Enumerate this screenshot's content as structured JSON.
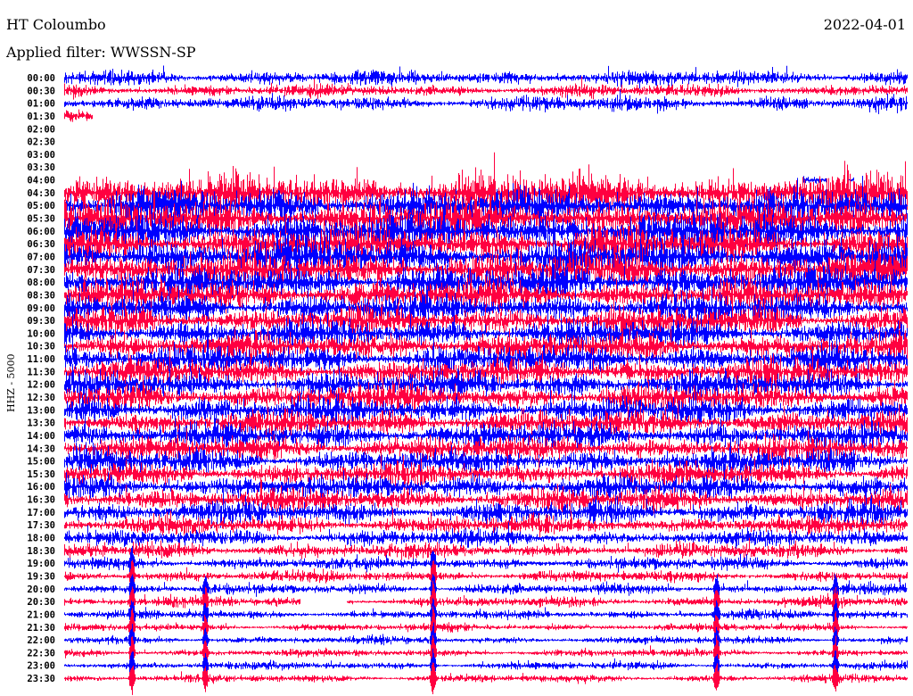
{
  "header": {
    "station": "HT Coloumbo",
    "filter": "Applied filter: WWSSN-SP",
    "date": "2022-04-01"
  },
  "chart_data": {
    "type": "line",
    "title": "HT Coloumbo",
    "subtitle": "Applied filter: WWSSN-SP",
    "ylabel": "HHZ - 5000",
    "xlabel": "",
    "minutes_per_line": 30,
    "colors": {
      "even": "#0000ff",
      "odd": "#ff0040"
    },
    "rows": [
      {
        "time": "00:00",
        "amp": 1.2
      },
      {
        "time": "00:30",
        "amp": 1.0
      },
      {
        "time": "01:00",
        "amp": 1.2
      },
      {
        "time": "01:30",
        "amp": 1.2,
        "coverage": [
          [
            0,
            0.033
          ]
        ]
      },
      {
        "time": "02:00",
        "amp": 0
      },
      {
        "time": "02:30",
        "amp": 0
      },
      {
        "time": "03:00",
        "amp": 0
      },
      {
        "time": "03:30",
        "amp": 0
      },
      {
        "time": "04:00",
        "amp": 0.9,
        "coverage": [
          [
            0.875,
            0.903
          ],
          [
            0.928,
            0.936
          ]
        ]
      },
      {
        "time": "04:30",
        "amp": 3.4
      },
      {
        "time": "05:00",
        "amp": 3.0
      },
      {
        "time": "05:30",
        "amp": 3.2
      },
      {
        "time": "06:00",
        "amp": 3.2
      },
      {
        "time": "06:30",
        "amp": 3.0
      },
      {
        "time": "07:00",
        "amp": 3.2
      },
      {
        "time": "07:30",
        "amp": 3.0
      },
      {
        "time": "08:00",
        "amp": 2.8
      },
      {
        "time": "08:30",
        "amp": 2.6
      },
      {
        "time": "09:00",
        "amp": 2.4
      },
      {
        "time": "09:30",
        "amp": 2.4
      },
      {
        "time": "10:00",
        "amp": 2.3
      },
      {
        "time": "10:30",
        "amp": 2.3
      },
      {
        "time": "11:00",
        "amp": 2.3
      },
      {
        "time": "11:30",
        "amp": 2.2
      },
      {
        "time": "12:00",
        "amp": 2.2
      },
      {
        "time": "12:30",
        "amp": 2.2
      },
      {
        "time": "13:00",
        "amp": 2.2
      },
      {
        "time": "13:30",
        "amp": 2.1
      },
      {
        "time": "14:00",
        "amp": 2.1
      },
      {
        "time": "14:30",
        "amp": 2.0
      },
      {
        "time": "15:00",
        "amp": 2.0
      },
      {
        "time": "15:30",
        "amp": 1.9
      },
      {
        "time": "16:00",
        "amp": 1.9
      },
      {
        "time": "16:30",
        "amp": 1.9
      },
      {
        "time": "17:00",
        "amp": 1.8
      },
      {
        "time": "17:30",
        "amp": 1.5
      },
      {
        "time": "18:00",
        "amp": 1.3
      },
      {
        "time": "18:30",
        "amp": 1.2
      },
      {
        "time": "19:00",
        "amp": 1.0
      },
      {
        "time": "19:30",
        "amp": 0.9
      },
      {
        "time": "20:00",
        "amp": 0.8
      },
      {
        "time": "20:30",
        "amp": 0.8,
        "coverage": [
          [
            0,
            0.28
          ],
          [
            0.335,
            1
          ]
        ]
      },
      {
        "time": "21:00",
        "amp": 0.7
      },
      {
        "time": "21:30",
        "amp": 0.6
      },
      {
        "time": "22:00",
        "amp": 0.6
      },
      {
        "time": "22:30",
        "amp": 0.6
      },
      {
        "time": "23:00",
        "amp": 0.6
      },
      {
        "time": "23:30",
        "amp": 0.6
      }
    ],
    "events": [
      {
        "pos": 0.08,
        "from_row": 38,
        "strength": 4
      },
      {
        "pos": 0.167,
        "from_row": 40,
        "strength": 3
      },
      {
        "pos": 0.437,
        "from_row": 38,
        "strength": 4
      },
      {
        "pos": 0.773,
        "from_row": 40,
        "strength": 3.5
      },
      {
        "pos": 0.914,
        "from_row": 40,
        "strength": 3.5
      }
    ]
  }
}
